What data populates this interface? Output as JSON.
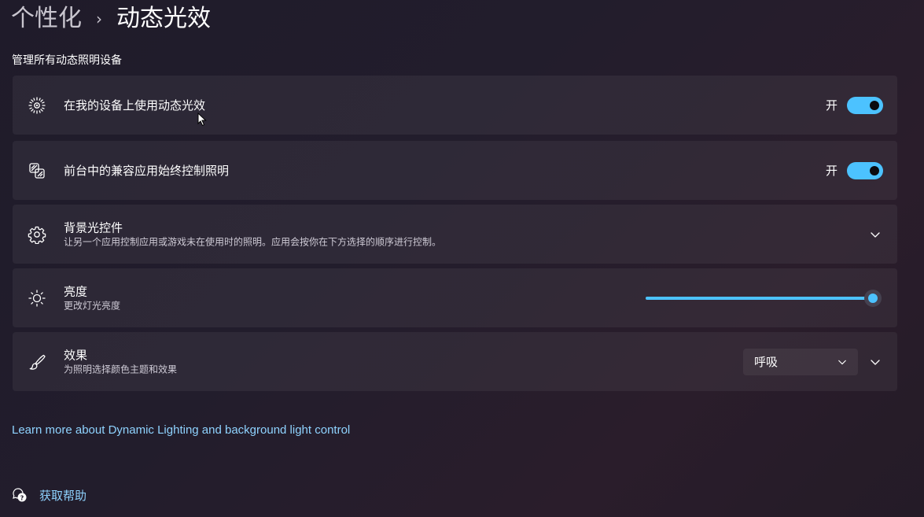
{
  "breadcrumb": {
    "parent": "个性化",
    "separator": "›",
    "current": "动态光效"
  },
  "section_title": "管理所有动态照明设备",
  "settings": {
    "use_dynamic_lighting": {
      "label": "在我的设备上使用动态光效",
      "state_label": "开",
      "enabled": true,
      "icon": "dynamic-lighting-icon"
    },
    "compatible_apps": {
      "label": "前台中的兼容应用始终控制照明",
      "state_label": "开",
      "enabled": true,
      "icon": "apps-control-icon"
    },
    "background_control": {
      "label": "背景光控件",
      "description": "让另一个应用控制应用或游戏未在使用时的照明。应用会按你在下方选择的顺序进行控制。",
      "icon": "gear-icon"
    },
    "brightness": {
      "label": "亮度",
      "description": "更改灯光亮度",
      "value_percent": 100,
      "icon": "sun-icon"
    },
    "effects": {
      "label": "效果",
      "description": "为照明选择颜色主题和效果",
      "selected": "呼吸",
      "icon": "brush-icon"
    }
  },
  "learn_more_link": "Learn more about Dynamic Lighting and background light control",
  "help": {
    "label": "获取帮助",
    "icon": "help-icon"
  },
  "colors": {
    "accent": "#4cc2ff",
    "link": "#8fd3ff"
  }
}
